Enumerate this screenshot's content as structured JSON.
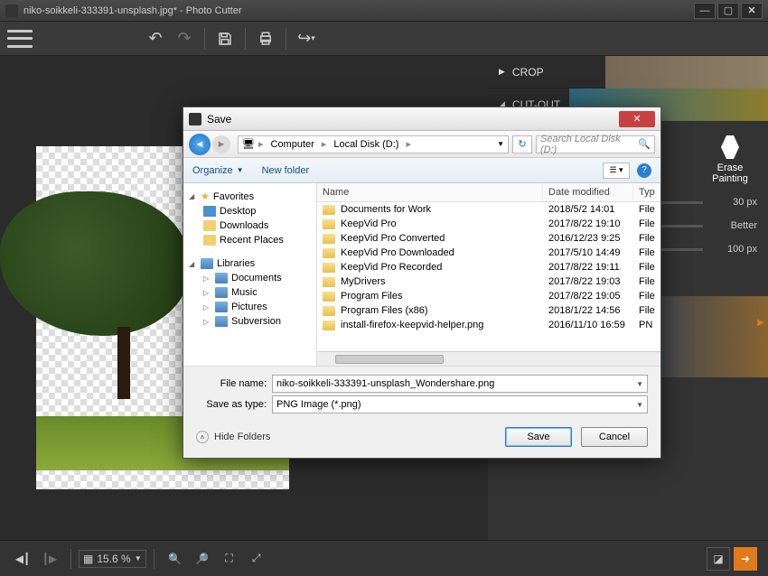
{
  "app": {
    "title": "niko-soikkeli-333391-unsplash.jpg* - Photo Cutter"
  },
  "panels": {
    "crop": "CROP",
    "cutout": "CUT-OUT",
    "erase_tool": "Erase",
    "painting": "Painting",
    "slider1_value": "30 px",
    "slider2_label": "Better",
    "slider3_value": "100 px"
  },
  "statusbar": {
    "zoom": "15.6 %"
  },
  "dialog": {
    "title": "Save",
    "breadcrumb": {
      "computer": "Computer",
      "drive": "Local Disk (D:)"
    },
    "search_placeholder": "Search Local Disk (D:)",
    "organize": "Organize",
    "new_folder": "New folder",
    "tree": {
      "favorites": "Favorites",
      "desktop": "Desktop",
      "downloads": "Downloads",
      "recent": "Recent Places",
      "libraries": "Libraries",
      "documents": "Documents",
      "music": "Music",
      "pictures": "Pictures",
      "subversion": "Subversion"
    },
    "columns": {
      "name": "Name",
      "date": "Date modified",
      "type": "Typ"
    },
    "rows": [
      {
        "name": "Documents for Work",
        "date": "2018/5/2 14:01",
        "type": "File"
      },
      {
        "name": "KeepVid Pro",
        "date": "2017/8/22 19:10",
        "type": "File"
      },
      {
        "name": "KeepVid Pro Converted",
        "date": "2016/12/23 9:25",
        "type": "File"
      },
      {
        "name": "KeepVid Pro Downloaded",
        "date": "2017/5/10 14:49",
        "type": "File"
      },
      {
        "name": "KeepVid Pro Recorded",
        "date": "2017/8/22 19:11",
        "type": "File"
      },
      {
        "name": "MyDrivers",
        "date": "2017/8/22 19:03",
        "type": "File"
      },
      {
        "name": "Program Files",
        "date": "2017/8/22 19:05",
        "type": "File"
      },
      {
        "name": "Program Files (x86)",
        "date": "2018/1/22 14:56",
        "type": "File"
      },
      {
        "name": "install-firefox-keepvid-helper.png",
        "date": "2016/11/10 16:59",
        "type": "PN"
      }
    ],
    "filename_label": "File name:",
    "filename_value": "niko-soikkeli-333391-unsplash_Wondershare.png",
    "saveas_label": "Save as type:",
    "saveas_value": "PNG Image (*.png)",
    "hide_folders": "Hide Folders",
    "save_btn": "Save",
    "cancel_btn": "Cancel"
  }
}
